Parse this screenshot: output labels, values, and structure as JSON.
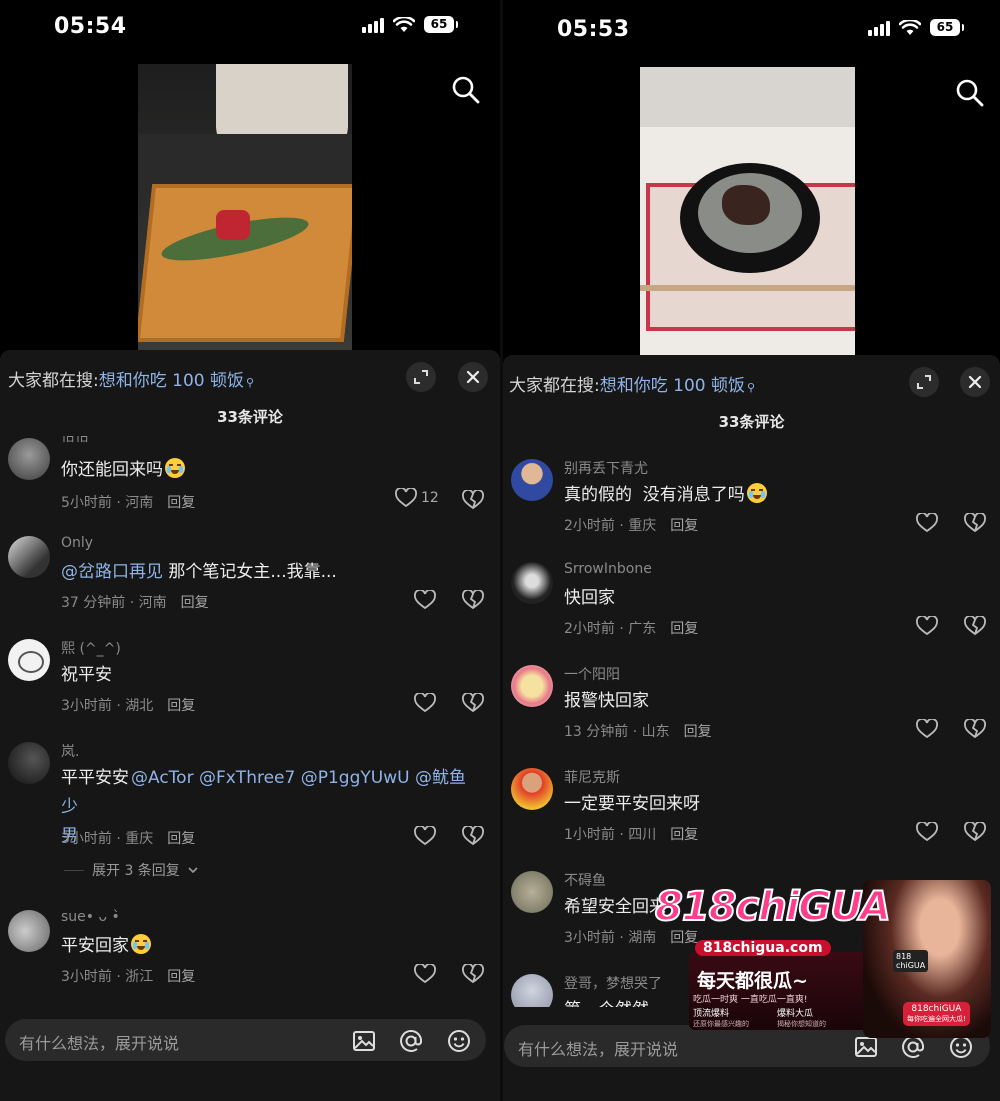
{
  "screens": [
    {
      "status": {
        "time": "05:54",
        "battery": "65"
      },
      "hot_search": {
        "prefix": "大家都在搜:",
        "query": "想和你吃 100 顿饭"
      },
      "comments_title": "33条评论",
      "comments": [
        {
          "user": "怡怡",
          "text": "你还能回来吗",
          "emoji": "laugh",
          "time": "5小时前 · 河南",
          "reply": "回复",
          "likes": "12"
        },
        {
          "user": "Only",
          "mention": "@岔路口再见",
          "text": " 那个笔记女主...我靠...",
          "time": "37 分钟前 · 河南",
          "reply": "回复",
          "likes": ""
        },
        {
          "user": "熙 (^_^)",
          "text": "祝平安",
          "time": "3小时前 · 湖北",
          "reply": "回复",
          "likes": ""
        },
        {
          "user": "岚.",
          "text": "平平安安",
          "mentions_line1": "@AcTor @FxThree7 @P1ggYUwU @鱿鱼少",
          "line2": "男",
          "time": "3小时前 · 重庆",
          "reply": "回复",
          "likes": "",
          "expand": "展开 3 条回复"
        },
        {
          "user": "sue• ᴗ •̀",
          "text": "平安回家",
          "emoji": "cry",
          "time": "3小时前 · 浙江",
          "reply": "回复",
          "likes": ""
        }
      ],
      "input_placeholder": "有什么想法，展开说说"
    },
    {
      "status": {
        "time": "05:53",
        "battery": "65"
      },
      "hot_search": {
        "prefix": "大家都在搜:",
        "query": "想和你吃 100 顿饭"
      },
      "comments_title": "33条评论",
      "comments": [
        {
          "user": "别再丢下青尤",
          "text": "真的假的  没有消息了吗",
          "emoji": "cry",
          "time": "2小时前 · 重庆",
          "reply": "回复"
        },
        {
          "user": "SrrowInbone",
          "text": "快回家",
          "time": "2小时前 · 广东",
          "reply": "回复"
        },
        {
          "user": "一个阳阳",
          "text": "报警快回家",
          "time": "13 分钟前 · 山东",
          "reply": "回复"
        },
        {
          "user": "菲尼克斯",
          "text": "一定要平安回来呀",
          "time": "1小时前 · 四川",
          "reply": "回复"
        },
        {
          "user": "不碍鱼",
          "text": "希望安全回来",
          "time": "3小时前 · 湖南",
          "reply": "回复"
        },
        {
          "user": "登哥，梦想哭了",
          "text": "第一个然然",
          "time": "",
          "reply": ""
        }
      ],
      "input_placeholder": "有什么想法，展开说说"
    }
  ],
  "ad": {
    "logo": "818chiGUA",
    "url": "818chigua.com",
    "slogan": "每天都很瓜~",
    "sub": "吃瓜一时爽 一直吃瓜一直爽!",
    "tag1": "顶流爆料",
    "tag1_sub": "还原你最感兴趣的",
    "tag2": "爆料大瓜",
    "tag2_sub": "揭秘你想知道的",
    "phone_label": "818\nchiGUA",
    "bubble": "818chiGUA",
    "bubble_sub": "每你吃遍全网大瓜!"
  },
  "colors": {
    "sheet": "#161616",
    "mention": "#8fb3e6",
    "muted": "#8a8a8a",
    "ad_pink": "#ff3d8a",
    "ad_red": "#d8203a"
  },
  "icons": [
    "search-icon",
    "expand-icon",
    "close-icon",
    "heart-icon",
    "dislike-icon",
    "image-icon",
    "at-icon",
    "emoji-icon",
    "chevron-down-icon"
  ]
}
